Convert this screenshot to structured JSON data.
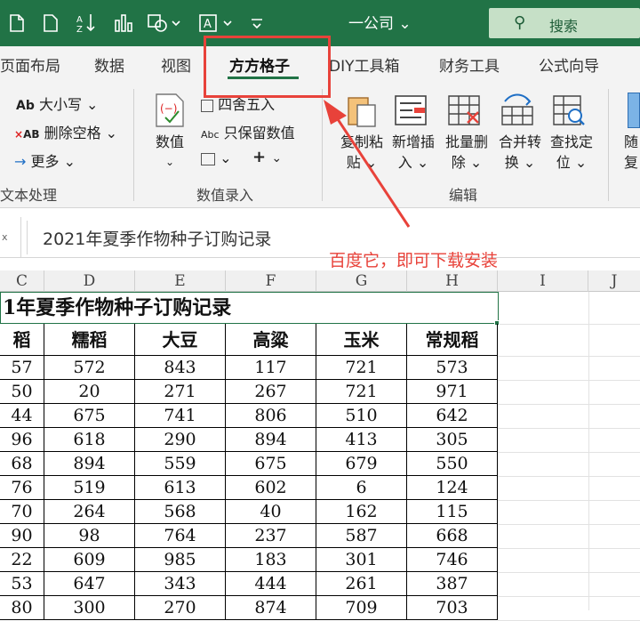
{
  "titlebar": {
    "title": "一公司 ⌄",
    "search_label": "搜索",
    "icons": [
      "document-icon",
      "sort-icon",
      "chart-icon",
      "shapes-icon",
      "textbox-icon",
      "customize-icon"
    ]
  },
  "tabs": [
    {
      "label": "页面布局"
    },
    {
      "label": "数据"
    },
    {
      "label": "视图"
    },
    {
      "label": "方方格子"
    },
    {
      "label": "DIY工具箱"
    },
    {
      "label": "财务工具"
    },
    {
      "label": "公式向导"
    }
  ],
  "ribbon": {
    "text_group": {
      "items": [
        "大小写 ⌄",
        "删除空格 ⌄",
        "更多 ⌄"
      ],
      "caption": "文本处理"
    },
    "numeric_group": {
      "big_button": "数值",
      "round_label": "四舍五入",
      "keep_numeric_label": "只保留数值",
      "caption": "数值录入"
    },
    "edit_group": {
      "buttons": [
        {
          "line1": "复制粘",
          "line2": "贴 ⌄"
        },
        {
          "line1": "新增插",
          "line2": "入 ⌄"
        },
        {
          "line1": "批量删",
          "line2": "除 ⌄"
        },
        {
          "line1": "合并转",
          "line2": "换 ⌄"
        },
        {
          "line1": "查找定",
          "line2": "位 ⌄"
        },
        {
          "line1": "随",
          "line2": "复"
        }
      ],
      "caption": "编辑"
    }
  },
  "formula_bar": {
    "namebox": "x",
    "content": "2021年夏季作物种子订购记录"
  },
  "columns": [
    "C",
    "D",
    "E",
    "F",
    "G",
    "H",
    "I",
    "J"
  ],
  "sheet": {
    "title": "1年夏季作物种子订购记录",
    "headers": [
      "稻",
      "糯稻",
      "大豆",
      "高粱",
      "玉米",
      "常规稻"
    ],
    "rows": [
      [
        "57",
        "572",
        "843",
        "117",
        "721",
        "573"
      ],
      [
        "50",
        "20",
        "271",
        "267",
        "721",
        "971"
      ],
      [
        "44",
        "675",
        "741",
        "806",
        "510",
        "642"
      ],
      [
        "96",
        "618",
        "290",
        "894",
        "413",
        "305"
      ],
      [
        "68",
        "894",
        "559",
        "675",
        "679",
        "550"
      ],
      [
        "76",
        "519",
        "613",
        "602",
        "6",
        "124"
      ],
      [
        "70",
        "264",
        "568",
        "40",
        "162",
        "115"
      ],
      [
        "90",
        "98",
        "764",
        "237",
        "587",
        "668"
      ],
      [
        "22",
        "609",
        "985",
        "183",
        "301",
        "746"
      ],
      [
        "53",
        "647",
        "343",
        "444",
        "261",
        "387"
      ],
      [
        "80",
        "300",
        "270",
        "874",
        "709",
        "703"
      ]
    ]
  },
  "annotation": {
    "text": "百度它，即可下载安装",
    "color": "#e8423a"
  },
  "colors": {
    "accent": "#217346",
    "annotation": "#e8423a"
  }
}
